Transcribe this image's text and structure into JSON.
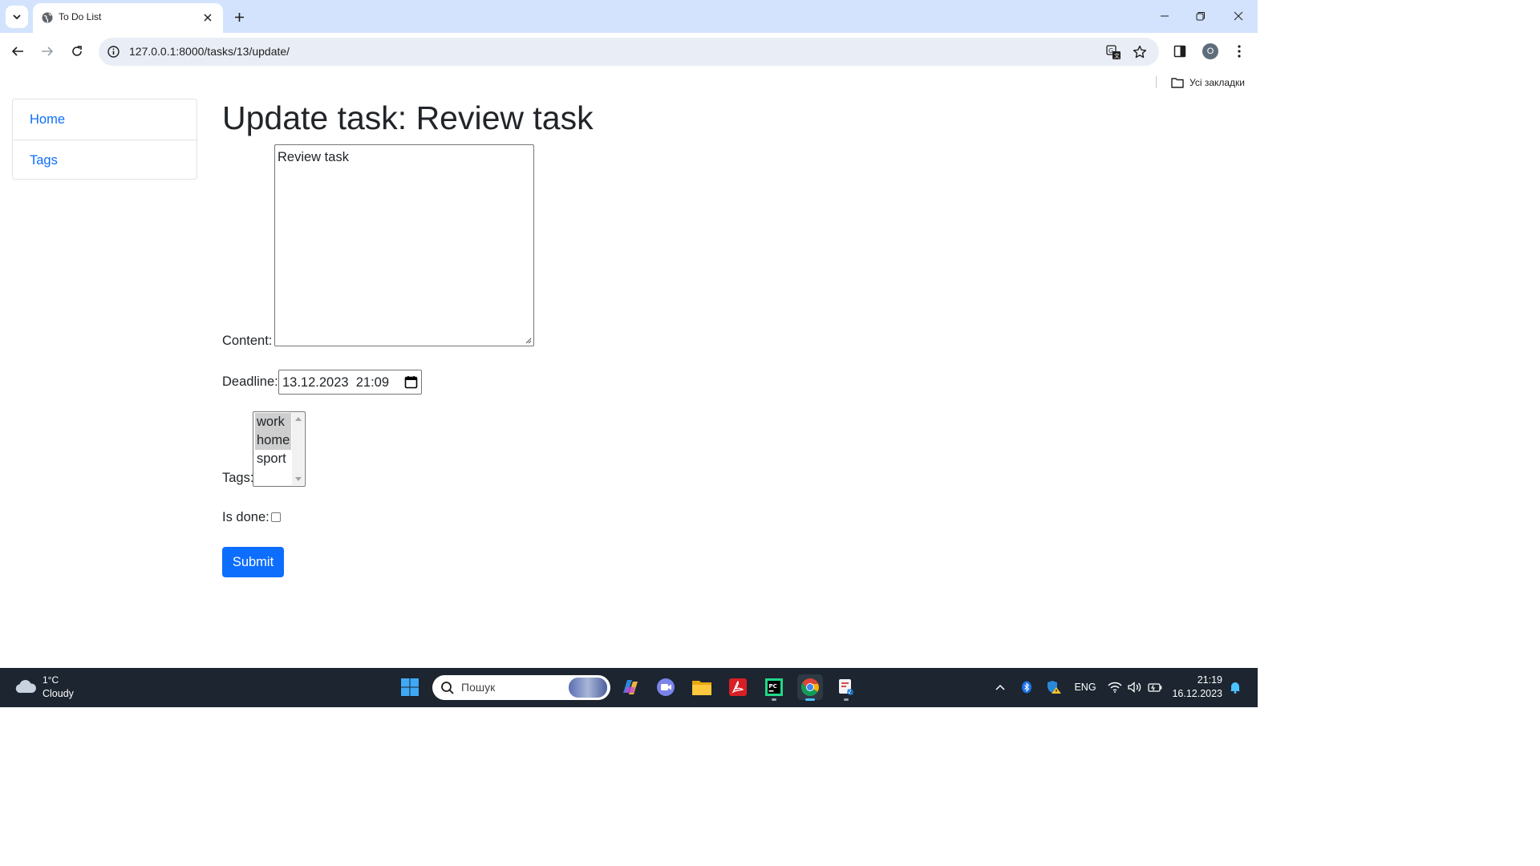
{
  "browser": {
    "tab_title": "To Do List",
    "url": "127.0.0.1:8000/tasks/13/update/",
    "profile_initial": "O",
    "bookmarks_all_label": "Усі закладки"
  },
  "sidebar": {
    "items": [
      {
        "label": "Home"
      },
      {
        "label": "Tags"
      }
    ]
  },
  "page": {
    "title": "Update task: Review task"
  },
  "form": {
    "content_label": "Content:",
    "content_value": "Review task",
    "deadline_label": "Deadline:",
    "deadline_value": "13.12.2023  21:09",
    "tags_label": "Tags:",
    "tags_options": [
      {
        "label": "work",
        "selected": true
      },
      {
        "label": "home",
        "selected": true
      },
      {
        "label": "sport",
        "selected": false
      }
    ],
    "is_done_label": "Is done:",
    "is_done_checked": false,
    "submit_label": "Submit"
  },
  "taskbar": {
    "weather_temp": "1°C",
    "weather_desc": "Cloudy",
    "search_placeholder": "Пошук",
    "language": "ENG",
    "time": "21:19",
    "date": "16.12.2023"
  },
  "colors": {
    "accent": "#0d6efd",
    "tabstrip": "#d3e3fd",
    "taskbar": "#1c2530"
  }
}
